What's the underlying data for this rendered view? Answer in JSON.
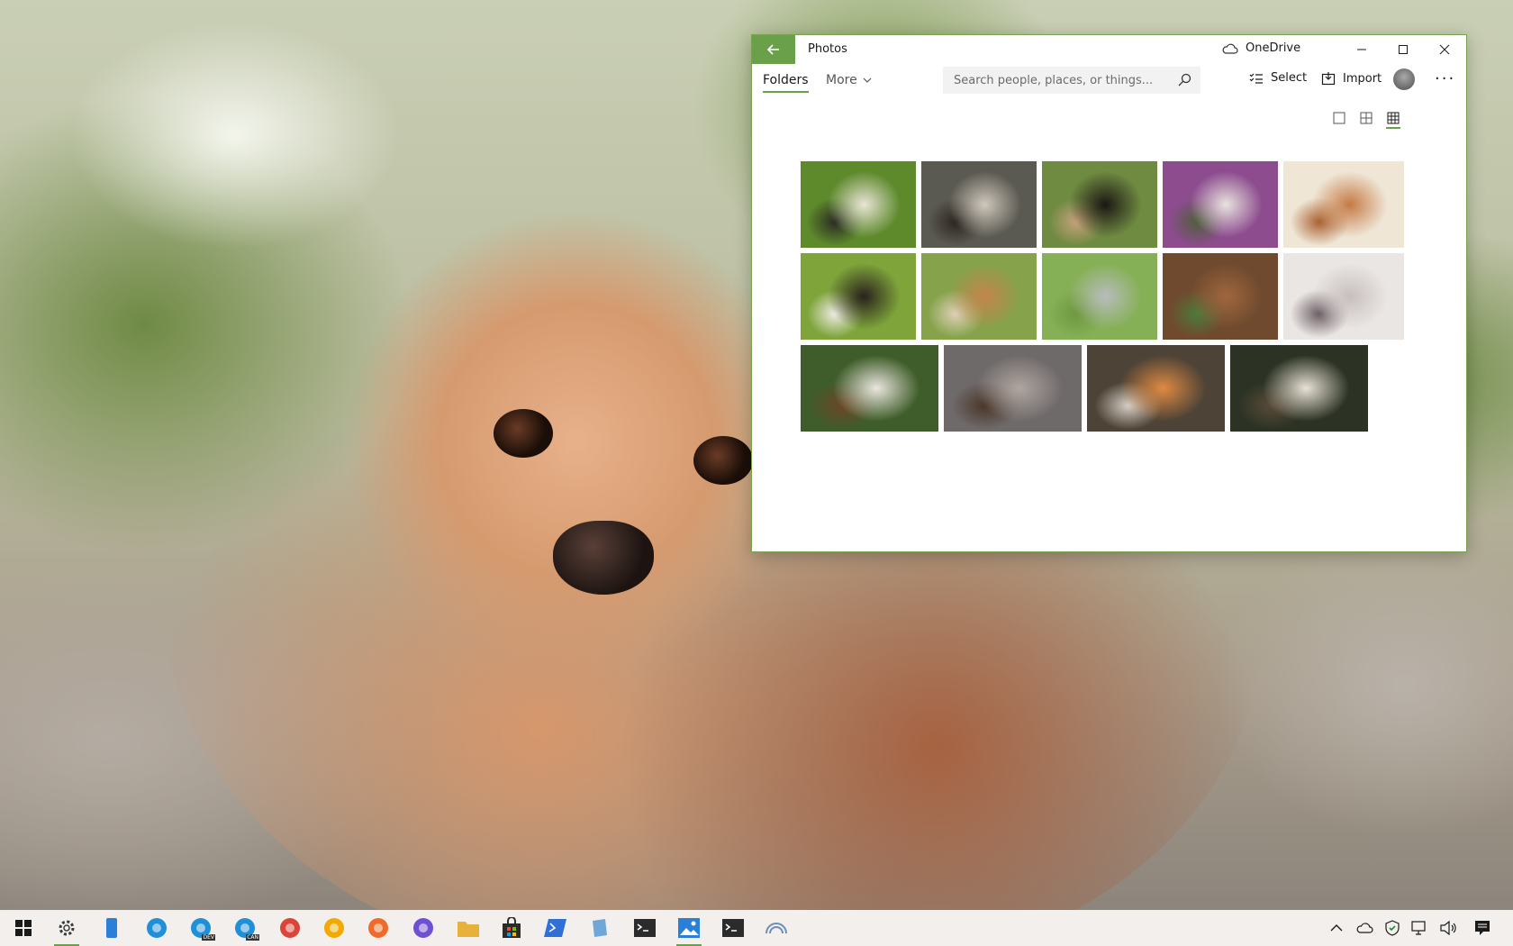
{
  "window": {
    "title": "Photos",
    "onedrive_label": "OneDrive",
    "accent_color": "#6ba04a"
  },
  "toolbar": {
    "tabs": [
      {
        "label": "Folders",
        "active": true
      },
      {
        "label": "More"
      }
    ],
    "search_placeholder": "Search people, places, or things...",
    "select_label": "Select",
    "import_label": "Import"
  },
  "view_modes": [
    "single-square-icon",
    "four-square-icon",
    "nine-square-icon"
  ],
  "gallery": {
    "rows": [
      [
        {
          "subject": "puppies in grass",
          "colors": [
            "#5e8a2c",
            "#e9e4d6",
            "#2a2a22"
          ]
        },
        {
          "subject": "siamese cat",
          "colors": [
            "#5b5a52",
            "#cfc7bb",
            "#2c2520"
          ]
        },
        {
          "subject": "bernese dog",
          "colors": [
            "#6f8a41",
            "#1c1714",
            "#c6a27b"
          ]
        },
        {
          "subject": "white cat in flowers",
          "colors": [
            "#8c4c8e",
            "#e8e3de",
            "#4f5f3a"
          ]
        },
        {
          "subject": "two poodles",
          "colors": [
            "#efe6d6",
            "#c57a45",
            "#a9602f"
          ]
        }
      ],
      [
        {
          "subject": "spaniel puppy",
          "colors": [
            "#7ea43a",
            "#2a211d",
            "#f0ece6"
          ]
        },
        {
          "subject": "dog lying on grass",
          "colors": [
            "#86a34b",
            "#c4844b",
            "#dfd1b8"
          ]
        },
        {
          "subject": "husky running",
          "colors": [
            "#86b056",
            "#b8bcbd",
            "#6e9740"
          ]
        },
        {
          "subject": "poodle close-up",
          "colors": [
            "#6f4a2e",
            "#a0673e",
            "#4d7a3b"
          ]
        },
        {
          "subject": "sleeping white cat",
          "colors": [
            "#eae6e3",
            "#c7bfbd",
            "#6b5d63"
          ]
        }
      ],
      [
        {
          "subject": "husky puppy",
          "colors": [
            "#3f5d2a",
            "#ebe6df",
            "#6b4628"
          ]
        },
        {
          "subject": "cat at window",
          "colors": [
            "#6f6a6a",
            "#b0a6a0",
            "#4a3528"
          ]
        },
        {
          "subject": "orange kittens",
          "colors": [
            "#4d4336",
            "#e08a42",
            "#d6cfc6"
          ]
        },
        {
          "subject": "white poodle",
          "colors": [
            "#2c3324",
            "#e9e2d6",
            "#5a4b3a"
          ]
        }
      ]
    ]
  },
  "taskbar": {
    "apps": [
      {
        "icon": "windows-start-icon",
        "color": "#1a1a1a"
      },
      {
        "icon": "settings-gear-icon",
        "color": "#3b3b3b"
      },
      {
        "icon": "phone-icon",
        "color": "#2b7fd6"
      },
      {
        "icon": "edge-icon",
        "color": "#1f8fd8"
      },
      {
        "icon": "edge-dev-icon",
        "color": "#1f8fd8",
        "badge": "DEV"
      },
      {
        "icon": "edge-canary-icon",
        "color": "#1f8fd8",
        "badge": "CAN"
      },
      {
        "icon": "chrome-icon",
        "color": "#db4437"
      },
      {
        "icon": "chrome-canary-icon",
        "color": "#f2a900"
      },
      {
        "icon": "firefox-icon",
        "color": "#f06a2a"
      },
      {
        "icon": "firefox-nightly-icon",
        "color": "#6f4fd6"
      },
      {
        "icon": "file-explorer-icon",
        "color": "#e8b13a"
      },
      {
        "icon": "store-icon",
        "color": "#2b2b2b"
      },
      {
        "icon": "powershell-icon",
        "color": "#2f6fd6"
      },
      {
        "icon": "notepad-icon",
        "color": "#6fa8d8"
      },
      {
        "icon": "terminal-icon",
        "color": "#2b2b2b"
      },
      {
        "icon": "photos-icon",
        "color": "#2b7fd6"
      },
      {
        "icon": "command-prompt-icon",
        "color": "#2b2b2b"
      },
      {
        "icon": "remote-desktop-icon",
        "color": "#6b8fb8"
      }
    ],
    "tray": [
      "chevron-up-icon",
      "onedrive-cloud-icon",
      "security-shield-icon",
      "network-icon",
      "volume-icon",
      "notification-icon"
    ]
  }
}
